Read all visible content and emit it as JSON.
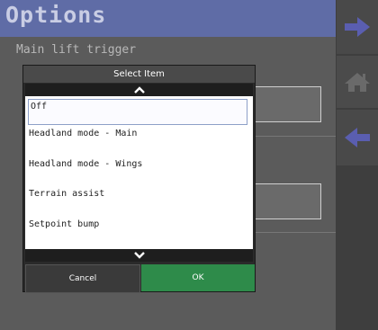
{
  "header": {
    "title": "Options"
  },
  "field": {
    "label": "Main lift trigger"
  },
  "dialog": {
    "title": "Select Item",
    "items": [
      "Off",
      "Headland mode - Main",
      "Headland mode - Wings",
      "Terrain assist",
      "Setpoint bump"
    ],
    "selected_index": 0,
    "cancel_label": "Cancel",
    "ok_label": "OK"
  },
  "side_nav": {
    "next_icon": "arrow-right-icon",
    "home_icon": "home-icon",
    "back_icon": "arrow-left-icon"
  },
  "colors": {
    "title_bar": "#5f6ca6",
    "ok_button": "#2e8b4a",
    "nav_arrows": "#5a5eb0"
  }
}
